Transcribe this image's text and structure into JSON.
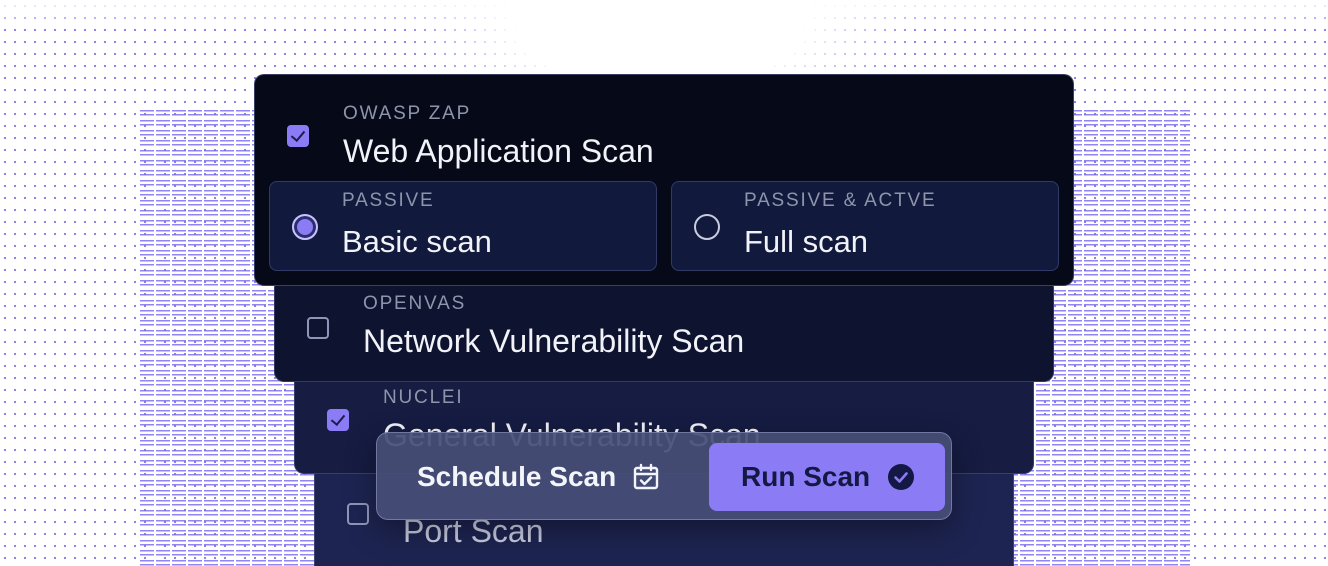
{
  "scans": [
    {
      "tool": "OWASP ZAP",
      "title": "Web Application Scan",
      "checked": true,
      "options": [
        {
          "mode": "PASSIVE",
          "label": "Basic scan",
          "selected": true
        },
        {
          "mode": "PASSIVE & ACTVE",
          "label": "Full scan",
          "selected": false
        }
      ]
    },
    {
      "tool": "OPENVAS",
      "title": "Network Vulnerability Scan",
      "checked": false
    },
    {
      "tool": "NUCLEI",
      "title": "General Vulnerability Scan",
      "checked": true
    },
    {
      "tool": "",
      "title": "Port Scan",
      "checked": false
    }
  ],
  "actions": {
    "schedule_label": "Schedule Scan",
    "schedule_icon": "calendar-check-icon",
    "run_label": "Run Scan",
    "run_icon": "check-circle-icon"
  },
  "colors": {
    "accent": "#8b7cf6",
    "card_dark": "#060a18",
    "pattern": "#7c6ff0"
  }
}
